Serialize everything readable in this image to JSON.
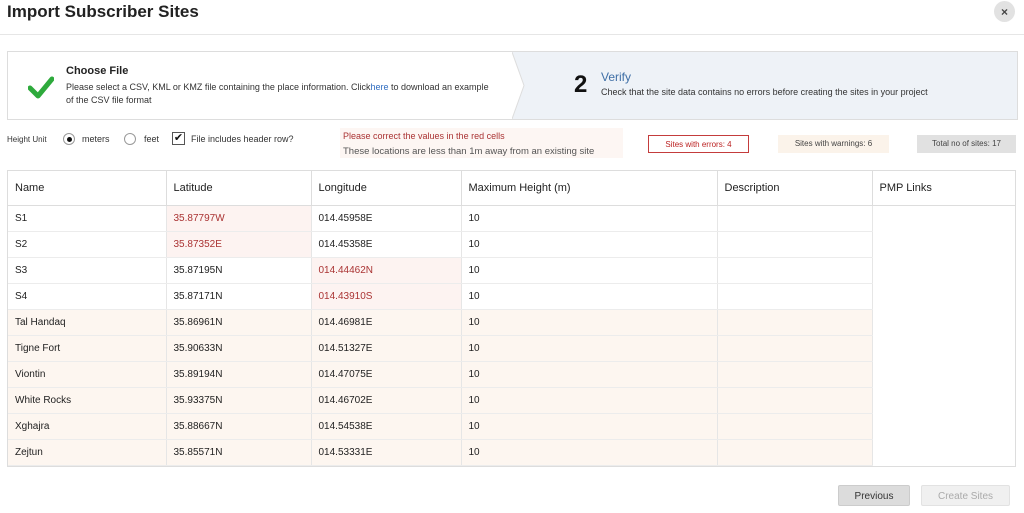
{
  "dialog": {
    "title": "Import Subscriber Sites",
    "close_glyph": "×"
  },
  "steps": {
    "choose": {
      "title": "Choose File",
      "desc_before": "Please select a CSV, KML or KMZ file containing the place information. Click",
      "link": "here",
      "desc_after": " to download an example of the CSV file format"
    },
    "verify": {
      "number": "2",
      "title": "Verify",
      "desc": "Check that the site data contains no errors before creating the sites in your project"
    }
  },
  "options": {
    "height_unit_label": "Height Unit",
    "meters_label": "meters",
    "feet_label": "feet",
    "selected_unit": "meters",
    "header_row_label": "File includes header row?",
    "header_row_checked": true
  },
  "notices": {
    "red": "Please correct the values in the red cells",
    "warning": "These locations are less than 1m away from an existing site"
  },
  "badges": {
    "errors": "Sites with errors: 4",
    "warnings": "Sites with warnings: 6",
    "total": "Total no of sites: 17"
  },
  "table": {
    "columns": [
      "Name",
      "Latitude",
      "Longitude",
      "Maximum Height (m)",
      "Description",
      "PMP Links"
    ],
    "rows": [
      {
        "name": "S1",
        "lat": "35.87797W",
        "lon": "014.45958E",
        "height": "10",
        "lat_err": true,
        "lon_err": false,
        "warn": false
      },
      {
        "name": "S2",
        "lat": "35.87352E",
        "lon": "014.45358E",
        "height": "10",
        "lat_err": true,
        "lon_err": false,
        "warn": false
      },
      {
        "name": "S3",
        "lat": "35.87195N",
        "lon": "014.44462N",
        "height": "10",
        "lat_err": false,
        "lon_err": true,
        "warn": false
      },
      {
        "name": "S4",
        "lat": "35.87171N",
        "lon": "014.43910S",
        "height": "10",
        "lat_err": false,
        "lon_err": true,
        "warn": false
      },
      {
        "name": "Tal Handaq",
        "lat": "35.86961N",
        "lon": "014.46981E",
        "height": "10",
        "lat_err": false,
        "lon_err": false,
        "warn": true
      },
      {
        "name": "Tigne Fort",
        "lat": "35.90633N",
        "lon": "014.51327E",
        "height": "10",
        "lat_err": false,
        "lon_err": false,
        "warn": true
      },
      {
        "name": "Viontin",
        "lat": "35.89194N",
        "lon": "014.47075E",
        "height": "10",
        "lat_err": false,
        "lon_err": false,
        "warn": true
      },
      {
        "name": "White Rocks",
        "lat": "35.93375N",
        "lon": "014.46702E",
        "height": "10",
        "lat_err": false,
        "lon_err": false,
        "warn": true
      },
      {
        "name": "Xghajra",
        "lat": "35.88667N",
        "lon": "014.54538E",
        "height": "10",
        "lat_err": false,
        "lon_err": false,
        "warn": true
      },
      {
        "name": "Zejtun",
        "lat": "35.85571N",
        "lon": "014.53331E",
        "height": "10",
        "lat_err": false,
        "lon_err": false,
        "warn": true
      }
    ]
  },
  "footer": {
    "previous": "Previous",
    "create": "Create Sites"
  },
  "colors": {
    "accent": "#2f6cc0",
    "error": "#a33333",
    "success": "#2eaa3c",
    "step_active_bg": "#eef2f7"
  }
}
